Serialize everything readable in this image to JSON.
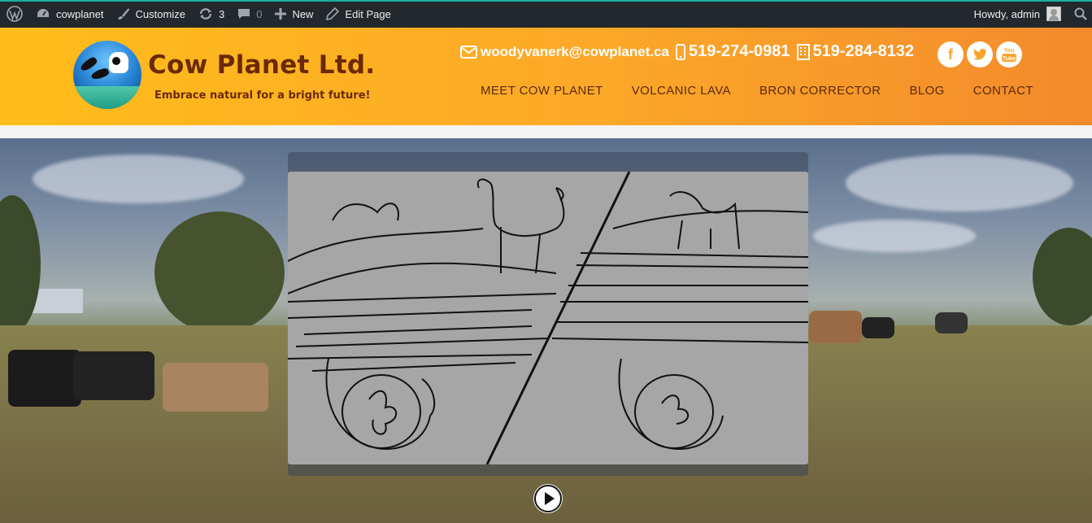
{
  "adminbar": {
    "site_name": "cowplanet",
    "customize": "Customize",
    "updates_count": "3",
    "comments_count": "0",
    "new_label": "New",
    "edit_page": "Edit Page",
    "howdy": "Howdy, admin"
  },
  "header": {
    "brand_title": "Cow Planet Ltd.",
    "tagline": "Embrace natural for a bright future!",
    "email": "woodyvanerk@cowplanet.ca",
    "phone_mobile": "519-274-0981",
    "phone_office": "519-284-8132",
    "socials": [
      "facebook-icon",
      "twitter-icon",
      "youtube-icon"
    ],
    "nav": [
      "MEET COW PLANET",
      "VOLCANIC LAVA",
      "BRON CORRECTOR",
      "BLOG",
      "CONTACT"
    ]
  },
  "colors": {
    "adminbar_bg": "#23282d",
    "header_start": "#ffbd1a",
    "header_end": "#f38a2c",
    "nav_text": "#5a2a10",
    "brand_text": "#6a2a06"
  },
  "hero": {
    "media": "video-thumbnail-sketch",
    "play_icon": "play-icon"
  }
}
